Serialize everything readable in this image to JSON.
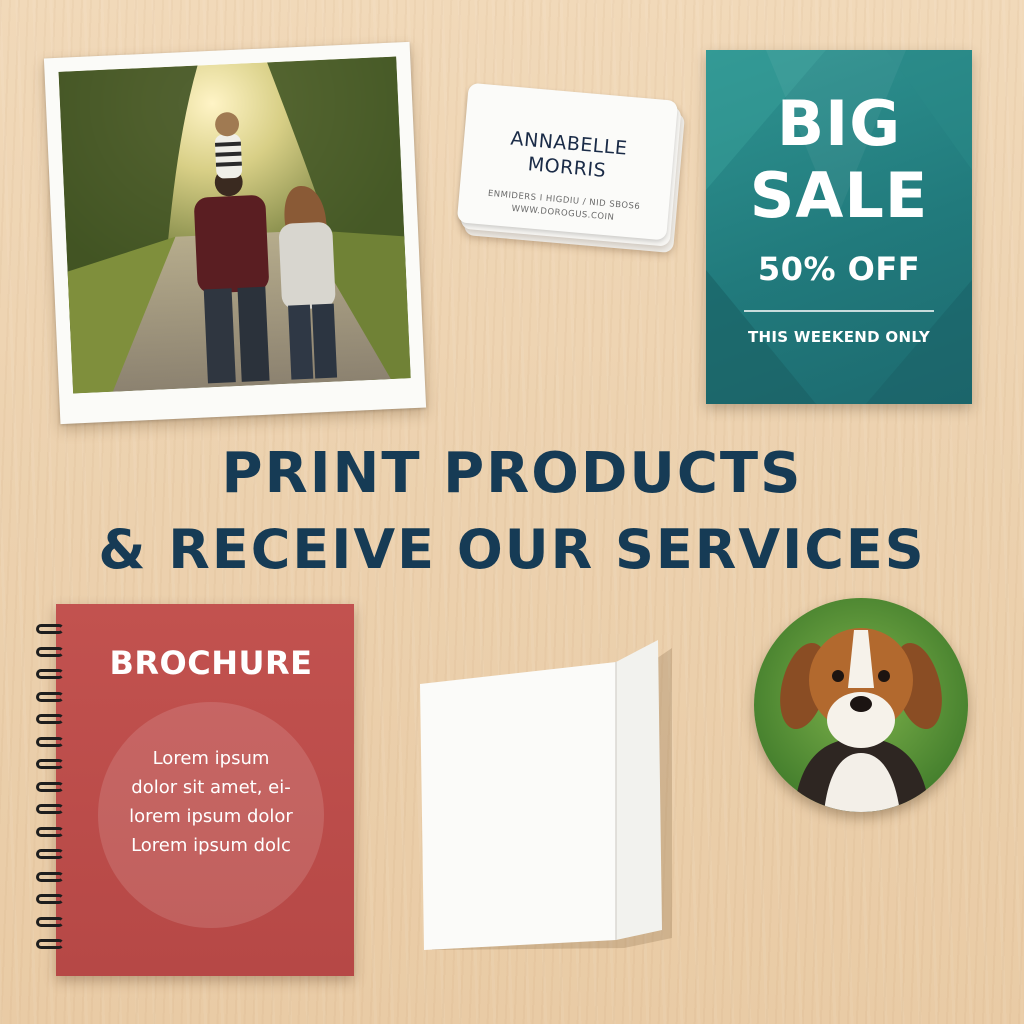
{
  "business_card": {
    "name": "ANNABELLE\nMORRIS",
    "detail_line": "ENMIDERS I HIGDIU / NID SBOS6",
    "web_line": "WWW.DOROGUS.COIN"
  },
  "sale_poster": {
    "headline": "BIG SALE",
    "headline_line1": "BIG",
    "headline_line2": "SALE",
    "discount": "50% OFF",
    "note": "THIS WEEKEND ONLY",
    "color": "#217a7c"
  },
  "headline": {
    "line1": "PRINT PRODUCTS",
    "line2": "& RECEIVE OUR SERVICES",
    "color": "#163b55"
  },
  "brochure": {
    "title": "BROCHURE",
    "body_lines": [
      "Lorem ipsum",
      "dolor sit amet, ei-",
      "lorem ipsum dolor",
      "Lorem ipsum dolc"
    ],
    "color": "#b64846"
  },
  "products": [
    "photo-print",
    "business-cards",
    "sale-poster",
    "spiral-brochure",
    "greeting-card",
    "photo-button-badge"
  ]
}
